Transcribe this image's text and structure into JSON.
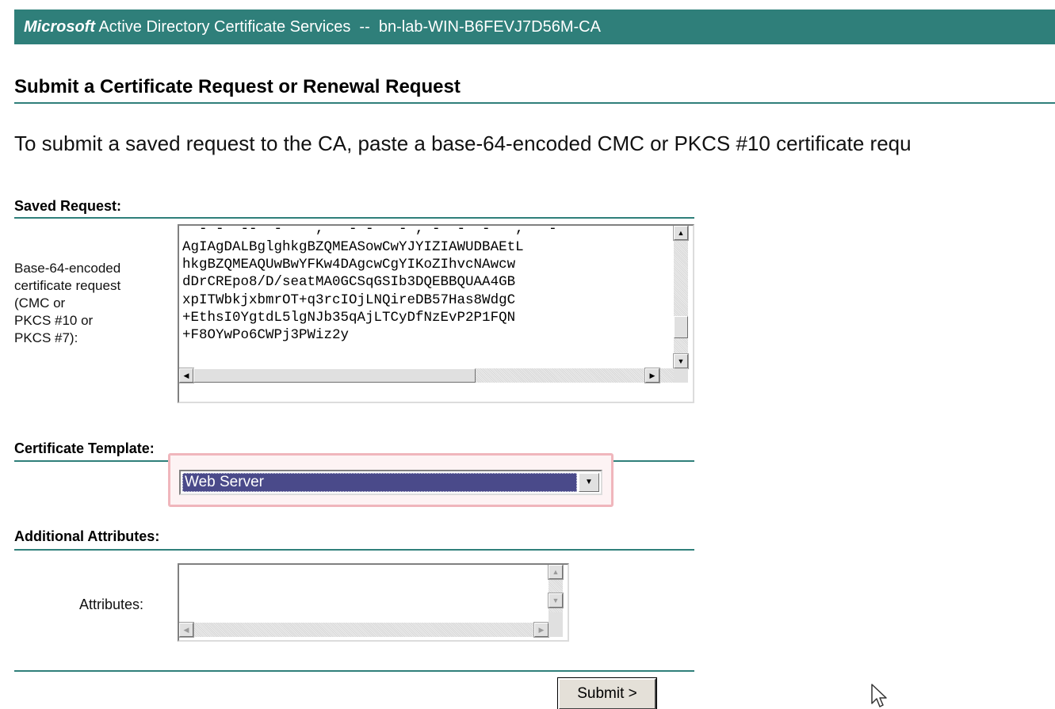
{
  "header": {
    "brand": "Microsoft",
    "title_rest": " Active Directory Certificate Services  --  bn-lab-WIN-B6FEVJ7D56M-CA"
  },
  "page": {
    "title": "Submit a Certificate Request or Renewal Request",
    "intro": "To submit a saved request to the CA, paste a base-64-encoded CMC or PKCS #10 certificate requ"
  },
  "saved_request": {
    "section_label": "Saved Request:",
    "field_label_lines": [
      "Base-64-encoded",
      "certificate request",
      "(CMC or",
      "PKCS #10 or",
      "PKCS #7):"
    ],
    "textarea_lines": [
      "AgIAgDALBglghkgBZQMEASowCwYJYIZIAWUDBAEtL",
      "hkgBZQMEAQUwBwYFKw4DAgcwCgYIKoZIhvcNAwcw",
      "dDrCREpo8/D/seatMA0GCSqGSIb3DQEBBQUAA4GB",
      "xpITWbkjxbmrOT+q3rcIOjLNQireDB57Has8WdgC",
      "+EthsI0YgtdL5lgNJb35qAjLTCyDfNzEvP2P1FQN",
      "+F8OYwPo6CWPj3PWiz2y"
    ]
  },
  "template": {
    "section_label": "Certificate Template:",
    "selected": "Web Server"
  },
  "attributes": {
    "section_label": "Additional Attributes:",
    "field_label": "Attributes:",
    "value": ""
  },
  "actions": {
    "submit_label": "Submit >"
  },
  "colors": {
    "accent": "#2f7f7a",
    "select_highlight": "#4a4a8a",
    "focus_ring": "#f0b6bc"
  }
}
